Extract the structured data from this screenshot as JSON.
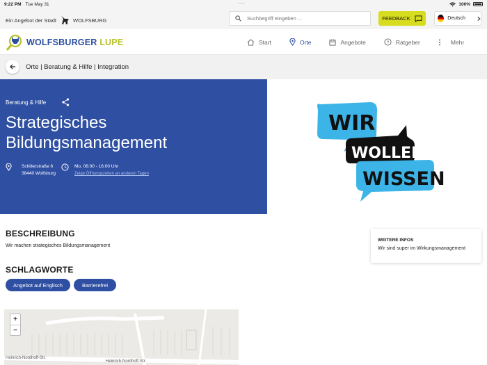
{
  "statusbar": {
    "time": "9:22 PM",
    "date": "Tue May 31",
    "battery": "100%"
  },
  "topbar": {
    "city_prefix": "Ein Angebot der Stadt",
    "city_name": "WOLFSBURG",
    "search_placeholder": "Suchbegriff eingeben ...",
    "feedback_label": "FEEDBACK",
    "language_label": "Deutsch"
  },
  "navbar": {
    "logo_main": "WOLFSBURGER",
    "logo_accent": "LUPE",
    "items": [
      {
        "label": "Start",
        "icon": "home-icon"
      },
      {
        "label": "Orte",
        "icon": "location-pin-icon",
        "active": true
      },
      {
        "label": "Angebote",
        "icon": "calendar-icon"
      },
      {
        "label": "Ratgeber",
        "icon": "help-circle-icon"
      },
      {
        "label": "Mehr",
        "icon": "more-vertical-icon"
      }
    ]
  },
  "breadcrumb": {
    "text": "Orte | Beratung & Hilfe | Integration"
  },
  "hero": {
    "category": "Beratung & Hilfe",
    "title": "Strategisches Bildungsmanagement",
    "address_line1": "Schillerstraße 6",
    "address_line2": "38440 Wolfsburg",
    "hours": "Mo, 08:00 - 16:00 Uhr",
    "hours_link": "Zeige Öffnungszeiten an anderen Tagen",
    "image_words": [
      "WIR",
      "WOLLEN",
      "WISSEN"
    ]
  },
  "content": {
    "description_title": "BESCHREIBUNG",
    "description_text": "Wir machen strategisches Bildungsmanagement",
    "keywords_title": "SCHLAGWORTE",
    "tags": [
      "Angebot auf Englisch",
      "Barrierefrei"
    ],
    "info_title": "WEITERE INFOS",
    "info_text": "Wir sind super im Wirkungsmanagement"
  },
  "map": {
    "zoom_in": "+",
    "zoom_out": "−",
    "street_1": "Heinrich-Nordhoff-Str.",
    "street_2": "Heinrich-Nordhoff-Str."
  },
  "colors": {
    "primary": "#2f4fa2",
    "accent": "#d7dc1f",
    "image_blue": "#3db4e8"
  }
}
